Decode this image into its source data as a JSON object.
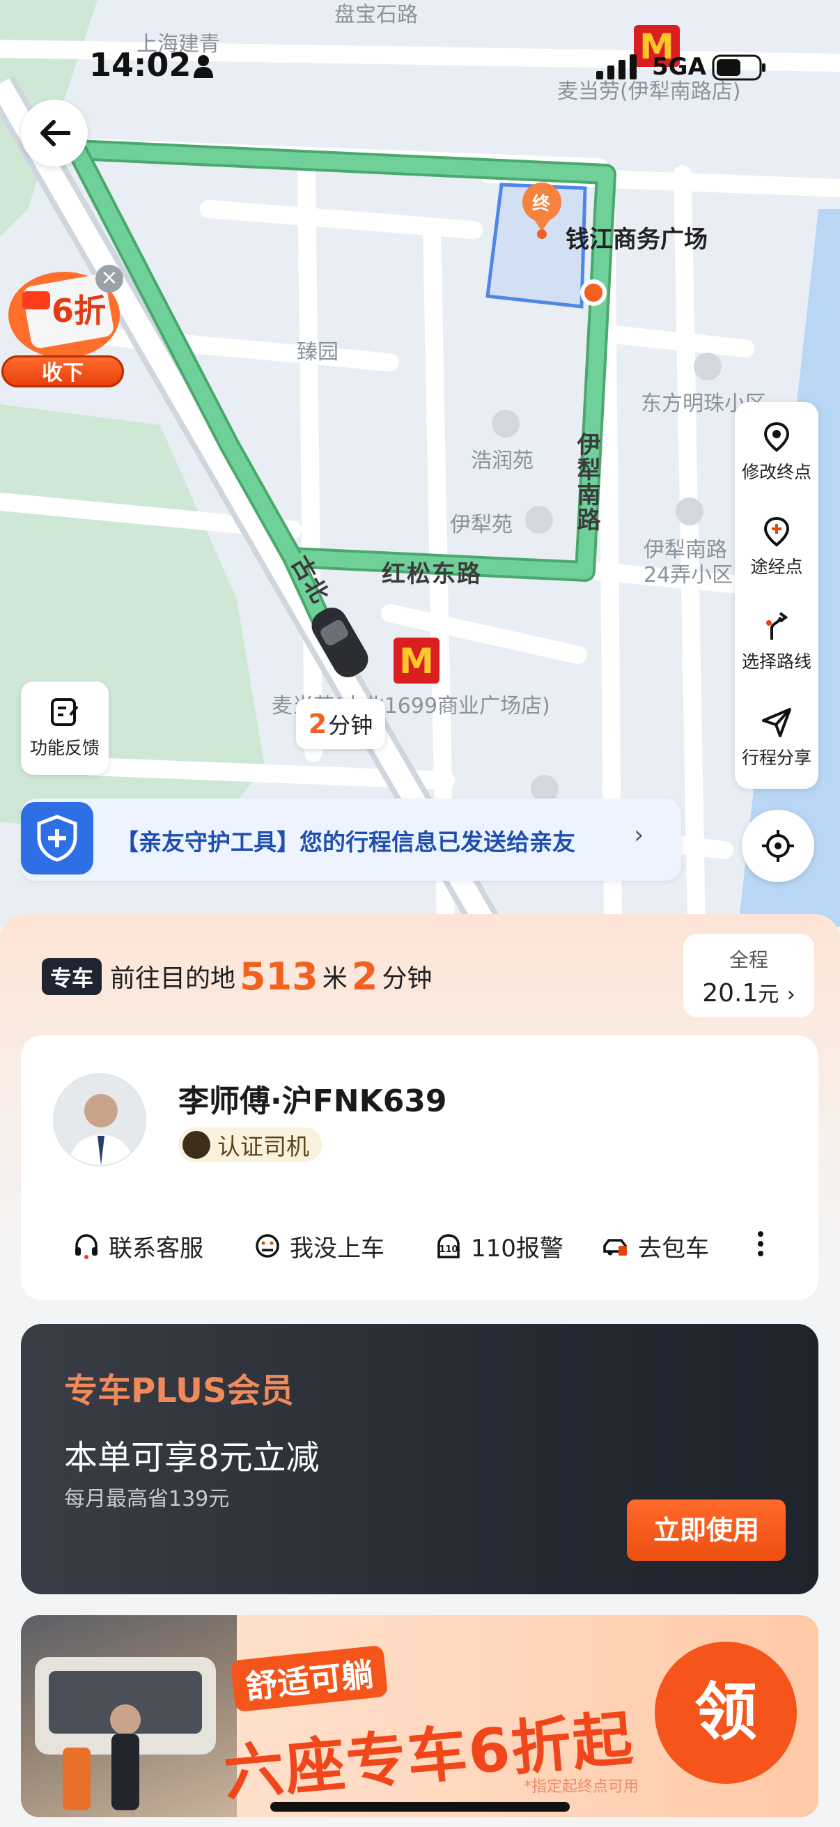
{
  "status": {
    "time": "14:02",
    "network": "5GA"
  },
  "map": {
    "labels": {
      "pan_shi_road": "盘宝石路",
      "shanghai_jianqing": "上海建青",
      "mcd_yili": "麦当劳(伊犁南路店)",
      "qianjiang": "钱江商务广场",
      "zhenyuan": "臻园",
      "dongfang": "东方明珠小区",
      "haorunyuan": "浩润苑",
      "yiliyuan": "伊犁苑",
      "yili_24": "伊犁南路",
      "yili_24b": "24弄小区",
      "mcd_gubei": "麦当劳(古北1699商业广场店)",
      "road_yili": "伊犁南路",
      "road_hongsong": "红松东路",
      "road_gu": "古北",
      "end_marker": "终"
    }
  },
  "promo_float": {
    "discount": "6折",
    "collapse_label": "收下"
  },
  "side_tools": [
    {
      "icon": "pin-icon",
      "label": "修改终点"
    },
    {
      "icon": "waypoint-icon",
      "label": "途经点"
    },
    {
      "icon": "route-icon",
      "label": "选择路线"
    },
    {
      "icon": "share-icon",
      "label": "行程分享"
    }
  ],
  "feedback": {
    "label": "功能反馈"
  },
  "eta_bubble": {
    "num": "2",
    "unit": "分钟"
  },
  "guard": {
    "text": "【亲友守护工具】您的行程信息已发送给亲友",
    "chevron": "›"
  },
  "trip": {
    "badge": "专车",
    "prefix": "前往目的地",
    "distance": "513",
    "distance_unit": "米",
    "minutes": "2",
    "minutes_unit": "分钟",
    "fare_label": "全程",
    "fare_value": "20.1",
    "fare_unit": "元",
    "fare_chevron": "›"
  },
  "driver": {
    "name": "李师傅·沪FNK639",
    "cert_label": "认证司机",
    "actions": [
      {
        "icon": "headset-icon",
        "label": "联系客服"
      },
      {
        "icon": "no-board-icon",
        "label": "我没上车"
      },
      {
        "icon": "police-icon",
        "label": "110报警"
      },
      {
        "icon": "car-rent-icon",
        "label": "去包车"
      }
    ],
    "more": "⋮"
  },
  "plus": {
    "title": "专车PLUS会员",
    "main": "本单可享8元立减",
    "sub": "每月最高省139元",
    "button": "立即使用"
  },
  "banner": {
    "tag": "舒适可躺",
    "title": "六座专车6折起",
    "note": "*指定起终点可用",
    "claim": "领"
  },
  "colors": {
    "accent": "#f2611f",
    "route": "#5fc489",
    "guard_blue": "#2f6fe6"
  }
}
